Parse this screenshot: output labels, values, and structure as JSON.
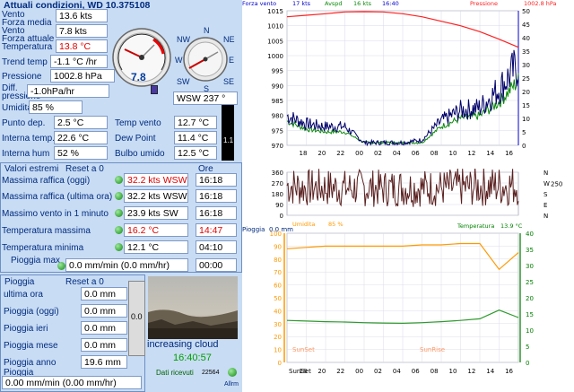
{
  "conditions": {
    "title": "Attuali condizioni, WD 10.375108",
    "rows": [
      {
        "label": "Vento",
        "value": "13.6 kts"
      },
      {
        "label": "Forza media",
        "value": ""
      },
      {
        "label": "Vento",
        "value": "7.8 kts"
      },
      {
        "label": "Forza attuale",
        "value": ""
      },
      {
        "label": "Temperatura",
        "value": "13.8 °C"
      }
    ],
    "trend_label": "Trend temp",
    "trend_value": "-1.1 °C /hr",
    "pressure_label": "Pressione",
    "pressure_value": "1002.8 hPa",
    "diff_label_1": "Diff.",
    "diff_label_2": "pressione",
    "diff_value": "-1.0hPa/hr",
    "humidity_label": "Umidita",
    "humidity_value": "85 %",
    "dew_label": "Punto dep.",
    "dew_value": "2.5 °C",
    "int_temp_label": "Interna temp.",
    "int_temp_value": "22.6 °C",
    "int_hum_label": "Interna hum",
    "int_hum_value": "52 %",
    "wind_temp_label": "Temp vento",
    "wind_temp_value": "12.7 °C",
    "dewpoint_label": "Dew Point",
    "dewpoint_value": "11.4 °C",
    "wetbulb_label": "Bulbo umido",
    "wetbulb_value": "12.5 °C",
    "side_value": "1.1",
    "gauge_value": "7.8",
    "compass_n": "N",
    "compass_ne": "NE",
    "compass_nw": "NW",
    "compass_w": "W",
    "compass_e": "E",
    "compass_sw": "SW",
    "compass_se": "SE",
    "compass_s": "S",
    "direction_value": "WSW 237 °"
  },
  "extremes": {
    "title": "Valori estremi",
    "reset_label": "Reset a 0",
    "time_header": "Ore",
    "rows": [
      {
        "label": "Massima raffica (oggi)",
        "value": "32.2 kts WSW",
        "time": "16:18",
        "red": true
      },
      {
        "label": "Massima raffica (ultima ora)",
        "value": "32.2 kts WSW",
        "time": "16:18",
        "red": false
      },
      {
        "label": "Massimo vento in 1 minuto",
        "value": "23.9 kts  SW",
        "time": "16:18",
        "red": false
      },
      {
        "label": "Temperatura massima",
        "value": "16.2 °C",
        "time": "14:47",
        "red": true
      },
      {
        "label": "Temperatura minima",
        "value": "12.1 °C",
        "time": "04:10",
        "red": false
      }
    ],
    "rain_max_label": "Pioggia max",
    "rain_max_value": "0.0 mm/min (0.0 mm/hr)",
    "rain_max_time": "00:00"
  },
  "rain": {
    "title": "Pioggia",
    "reset_label": "Reset a 0",
    "rows": [
      {
        "label": "ultima ora",
        "value": "0.0 mm"
      },
      {
        "label": "Pioggia (oggi)",
        "value": "0.0 mm"
      },
      {
        "label": "Pioggia ieri",
        "value": "0.0 mm"
      },
      {
        "label": "Pioggia mese",
        "value": "0.0 mm"
      },
      {
        "label": "Pioggia anno",
        "value": "19.6 mm"
      }
    ],
    "rate_label": "Pioggia",
    "rate_value": "0.00 mm/min (0.00 mm/hr)",
    "gauge_value": "0.0"
  },
  "status": {
    "forecast": "increasing cloud",
    "time": "16:40:57",
    "data_label": "Dati ricevuti",
    "data_count": "22564",
    "alarm_label": "Allrm"
  },
  "graph_top": {
    "legend_wind": "Forza vento",
    "legend_wind_value": "17 kts",
    "legend_avg": "Avspd",
    "legend_avg_value": "16 kts",
    "legend_time": "16:40",
    "legend_pressure": "Pressione",
    "legend_pressure_value": "1002.8 hPa",
    "left_ticks": [
      "1015",
      "1010",
      "1005",
      "1000",
      "995",
      "990",
      "985",
      "980",
      "975",
      "970"
    ],
    "right_ticks": [
      "50",
      "45",
      "40",
      "35",
      "30",
      "25",
      "20",
      "15",
      "10",
      "5",
      "0"
    ],
    "x_ticks": [
      "18",
      "20",
      "22",
      "00",
      "02",
      "04",
      "06",
      "08",
      "10",
      "12",
      "14",
      "16"
    ]
  },
  "graph_dir": {
    "left_ticks": [
      "360",
      "270",
      "180",
      "90",
      "0"
    ],
    "right_letters": [
      "N",
      "W",
      "S",
      "E",
      "N"
    ],
    "current": "250"
  },
  "graph_bottom": {
    "rain_label": "Pioggia",
    "rain_value": "0.0 mm",
    "hum_label": "Umidita",
    "hum_value": "85 %",
    "temp_label": "Temperatura",
    "temp_value": "13.9 °C",
    "left_ticks": [
      "100",
      "90",
      "80",
      "70",
      "60",
      "50",
      "40",
      "30",
      "20",
      "10",
      "0"
    ],
    "right_ticks": [
      "40",
      "35",
      "30",
      "25",
      "20",
      "15",
      "10",
      "5",
      "0"
    ],
    "x_ticks": [
      "18",
      "20",
      "22",
      "00",
      "02",
      "04",
      "06",
      "08",
      "10",
      "12",
      "14",
      "16"
    ],
    "sunset": "SunSet",
    "sunrise": "SunRise",
    "sunset_bottom": "SunSet"
  },
  "colors": {
    "panel": "#c8dcf4",
    "label": "#002b7f",
    "wind": "#00006a",
    "avg": "#0a8a0a",
    "pressure": "#ff2020",
    "humidity": "#ff9900",
    "temperature": "#2e9a2e",
    "direction": "#5a2020"
  },
  "chart_data": [
    {
      "type": "line",
      "title": "",
      "x_label": "hour",
      "x": [
        "16",
        "18",
        "20",
        "22",
        "00",
        "02",
        "04",
        "06",
        "08",
        "10",
        "12",
        "14",
        "16"
      ],
      "series": [
        {
          "name": "Forza vento",
          "axis": "right",
          "values": [
            11,
            8,
            7,
            7,
            1,
            1,
            1,
            2,
            9,
            13,
            14,
            21,
            30
          ]
        },
        {
          "name": "Avspd",
          "axis": "right",
          "values": [
            9,
            6,
            5,
            5,
            1,
            1,
            1,
            1,
            7,
            10,
            11,
            16,
            24
          ]
        },
        {
          "name": "Pressione",
          "axis": "left",
          "values": [
            1013,
            1013.5,
            1014,
            1014.6,
            1014.7,
            1014.6,
            1014,
            1013,
            1011.5,
            1010,
            1008,
            1005.5,
            1002.8
          ]
        }
      ],
      "ylim_left": [
        970,
        1015
      ],
      "ylim_right": [
        0,
        50
      ]
    },
    {
      "type": "line",
      "title": "",
      "x": [
        "16",
        "18",
        "20",
        "22",
        "00",
        "02",
        "04",
        "06",
        "08",
        "10",
        "12",
        "14",
        "16"
      ],
      "series": [
        {
          "name": "direction",
          "values": [
            250,
            228,
            232,
            226,
            230,
            225,
            232,
            230,
            228,
            233,
            240,
            245,
            250
          ]
        }
      ],
      "ylim": [
        0,
        360
      ]
    },
    {
      "type": "line",
      "title": "",
      "x": [
        "16",
        "18",
        "20",
        "22",
        "00",
        "02",
        "04",
        "06",
        "08",
        "10",
        "12",
        "14",
        "16"
      ],
      "series": [
        {
          "name": "Umidita",
          "axis": "left",
          "values": [
            88,
            89,
            90,
            90,
            90,
            90,
            90,
            91,
            91,
            92,
            92,
            72,
            85
          ]
        },
        {
          "name": "Temperatura",
          "axis": "right",
          "values": [
            13,
            12.8,
            12.6,
            12.5,
            12.3,
            12.2,
            12.1,
            12.3,
            12.6,
            13,
            13.5,
            16.2,
            13.9
          ]
        }
      ],
      "ylim_left": [
        0,
        100
      ],
      "ylim_right": [
        0,
        40
      ]
    }
  ]
}
